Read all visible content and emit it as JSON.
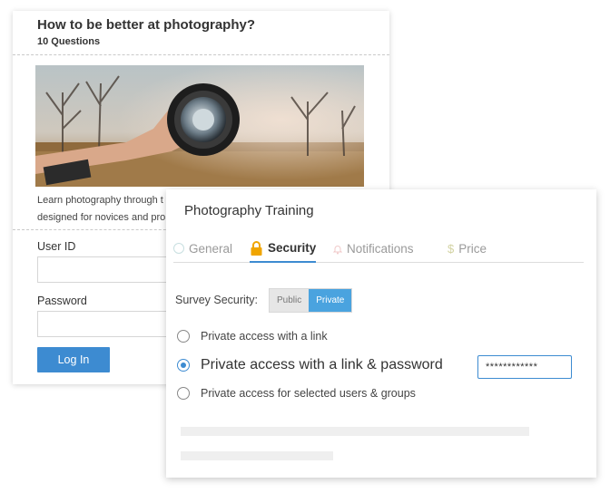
{
  "survey": {
    "title": "How to be better at photography?",
    "question_count": "10 Questions",
    "description_line1": "Learn photography through t",
    "description_line2": "designed for novices and pro",
    "user_id_label": "User ID",
    "password_label": "Password",
    "login_label": "Log In"
  },
  "settings": {
    "title": "Photography Training",
    "tabs": [
      {
        "label": "General",
        "icon": "circle-icon"
      },
      {
        "label": "Security",
        "icon": "lock-icon",
        "active": true
      },
      {
        "label": "Notifications",
        "icon": "bell-icon"
      },
      {
        "label": "Price",
        "icon": "dollar-icon"
      }
    ],
    "survey_security_label": "Survey Security:",
    "segment": {
      "public_label": "Public",
      "private_label": "Private",
      "selected": "Private"
    },
    "options": [
      {
        "label": "Private access with a link",
        "checked": false
      },
      {
        "label": "Private access with a link & password",
        "checked": true
      },
      {
        "label": "Private access for selected users & groups",
        "checked": false
      }
    ],
    "password_value": "************",
    "dollar_glyph": "$"
  },
  "colors": {
    "accent": "#3d8bd1",
    "private_active": "#4aa3df",
    "lock": "#f0a500"
  }
}
